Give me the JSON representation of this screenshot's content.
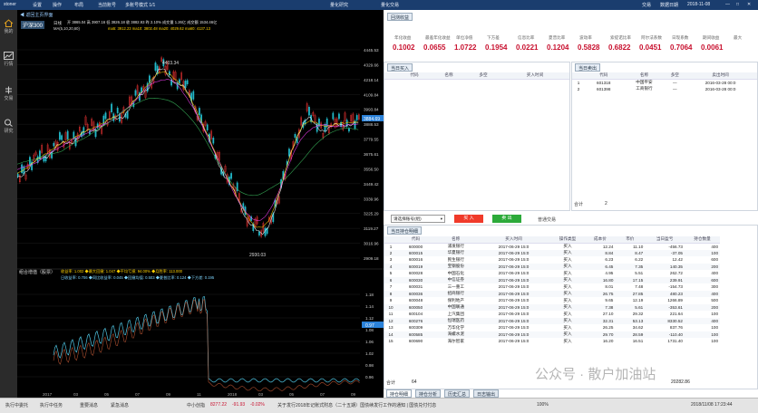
{
  "topbar": {
    "app": "stoner",
    "menu": [
      "设置",
      "操作",
      "布局",
      "当前账号",
      "多账号模式 1/1"
    ],
    "center": [
      "量化研究",
      "量化交易"
    ],
    "right": [
      "交易",
      "数据日期",
      "2018-11-08"
    ],
    "win": [
      "—",
      "□",
      "✕"
    ]
  },
  "nav": [
    {
      "label": "我的",
      "icon": "home-icon"
    },
    {
      "label": "行情",
      "icon": "chart-icon"
    },
    {
      "label": "交易",
      "icon": "trade-icon"
    },
    {
      "label": "研究",
      "icon": "research-icon"
    }
  ],
  "chart": {
    "back_label": "返回主页界面",
    "symbol": "沪深300",
    "period": "日线",
    "indicator": "MA(5,10,20,60)",
    "ohlc_line": "开 3865.04 高 3907.16 低 3826.18 收 3882.93 昨 2.10% 成交量 1.26亿 成交额 1534.46亿",
    "ma_line": "ma5: 3912.23 ma10: 3802.48 ma20: 4029.62 ma60: 4137.13",
    "high_label": "4403.34",
    "low_label": "2930.03",
    "price_ticks": [
      "4445.53",
      "4329.66",
      "4218.14",
      "4109.84",
      "3993.84",
      "3888.53",
      "3779.55",
      "3675.61",
      "3556.50",
      "3449.42",
      "3339.96",
      "3225.29",
      "3119.27",
      "3016.96",
      "2909.18"
    ],
    "current_price": "3884.69",
    "y_label": "3882.93",
    "sub_title": "组合增值（股票）",
    "sub_line1": "收益率: 1.002 ◆最大回撤: 1.047 ◆平均亏损: 94.00% ◆月胜率: 113.000",
    "sub_line2": "日收益率: 0.706 ◆同比收益率: 0.045 ◆回撤均值: 0.503 ◆夏普比率: 0.124 ◆下方差: 0.195",
    "sub_ticks": [
      "1.18",
      "1.14",
      "1.12",
      "1.08",
      "1.06",
      "1.02",
      "0.98",
      "0.96"
    ],
    "sub_current": "0.97",
    "x_ticks": [
      "2017",
      "03",
      "05",
      "07",
      "09",
      "11",
      "2018",
      "03",
      "05",
      "07",
      "09"
    ]
  },
  "results": {
    "tab": "回测收益",
    "metrics": [
      {
        "label": "年化收益",
        "value": "0.1002"
      },
      {
        "label": "最差年化收益",
        "value": "0.0655"
      },
      {
        "label": "单位净值",
        "value": "1.0722"
      },
      {
        "label": "下方差",
        "value": "0.1954"
      },
      {
        "label": "信息比率",
        "value": "0.0221"
      },
      {
        "label": "夏普比率",
        "value": "0.1204"
      },
      {
        "label": "波动率",
        "value": "0.5828"
      },
      {
        "label": "索提诺比率",
        "value": "0.6822"
      },
      {
        "label": "阿尔法系数",
        "value": "0.0451"
      },
      {
        "label": "日现系数",
        "value": "0.7064"
      },
      {
        "label": "期间收益",
        "value": "0.0061"
      },
      {
        "label": "最大"
      }
    ]
  },
  "buy_panel": {
    "tab": "当日买入",
    "cols": [
      "代码",
      "名称",
      "多空",
      "买入时间"
    ]
  },
  "sell_panel": {
    "tab": "当日卖出",
    "cols": [
      "代码",
      "名称",
      "多空",
      "卖出时间"
    ],
    "rows": [
      {
        "n": "1",
        "code": "601318",
        "name": "中国平安",
        "dir": "—",
        "time": "2016-03-28 00:0"
      },
      {
        "n": "2",
        "code": "601398",
        "name": "工商银行",
        "dir": "—",
        "time": "2016-03-28 00:0"
      }
    ],
    "total_label": "合计",
    "total_value": "2"
  },
  "controls": {
    "select": "请选择账号(组)",
    "buy": "买 入",
    "sell": "卖 出",
    "mode": "普通交易"
  },
  "holdings": {
    "tab": "当日持仓明细",
    "cols": [
      "代码",
      "名称",
      "买入时间",
      "操作类型",
      "成本价",
      "市价",
      "当日盈亏",
      "持仓数量"
    ],
    "rows": [
      [
        "1",
        "600000",
        "浦发银行",
        "2017-06-29 15:0",
        "买入",
        "12.24",
        "11.10",
        "-456.73",
        "400"
      ],
      [
        "2",
        "600015",
        "华夏银行",
        "2017-06-29 15:0",
        "买入",
        "8.84",
        "8.47",
        "-37.05",
        "100"
      ],
      [
        "3",
        "600016",
        "民生银行",
        "2017-06-29 15:0",
        "买入",
        "6.23",
        "6.22",
        "12.42",
        "600"
      ],
      [
        "4",
        "600019",
        "宝钢股份",
        "2017-06-29 15:0",
        "买入",
        "6.45",
        "7.35",
        "140.35",
        "200"
      ],
      [
        "5",
        "600028",
        "中国石化",
        "2017-06-29 15:0",
        "买入",
        "4.95",
        "5.51",
        "262.72",
        "400"
      ],
      [
        "6",
        "600030",
        "中信证券",
        "2017-06-29 15:0",
        "买入",
        "16.80",
        "17.15",
        "239.91",
        "600"
      ],
      [
        "7",
        "600031",
        "三一重工",
        "2017-06-29 15:0",
        "买入",
        "8.01",
        "7.48",
        "-154.73",
        "300"
      ],
      [
        "8",
        "600036",
        "招商银行",
        "2017-06-29 15:0",
        "买入",
        "26.75",
        "27.85",
        "480.23",
        "400"
      ],
      [
        "9",
        "600048",
        "保利地产",
        "2017-06-29 15:0",
        "买入",
        "9.65",
        "12.19",
        "1266.89",
        "500"
      ],
      [
        "10",
        "600050",
        "中国联通",
        "2017-06-29 15:0",
        "买入",
        "7.38",
        "5.61",
        "-353.61",
        "200"
      ],
      [
        "11",
        "600104",
        "上汽集团",
        "2017-06-29 15:0",
        "买入",
        "27.10",
        "29.32",
        "221.64",
        "100"
      ],
      [
        "12",
        "600276",
        "恒瑞医药",
        "2017-06-29 15:0",
        "买入",
        "32.31",
        "53.13",
        "8330.52",
        "400"
      ],
      [
        "13",
        "600309",
        "万华化学",
        "2017-06-29 15:0",
        "买入",
        "26.25",
        "34.62",
        "837.76",
        "100"
      ],
      [
        "14",
        "600585",
        "海螺水泥",
        "2017-06-29 15:0",
        "买入",
        "29.70",
        "28.59",
        "-110.40",
        "100"
      ],
      [
        "15",
        "600690",
        "海尔智家",
        "2017-06-29 15:0",
        "买入",
        "16.20",
        "16.51",
        "1731.40",
        "100"
      ]
    ],
    "total_label": "合计",
    "total_count": "64",
    "total_sum": "20282.86"
  },
  "bottom_tabs": [
    "持仓明细",
    "持仓分析",
    "历史汇总",
    "日志输出"
  ],
  "status": {
    "items": [
      "执行中委托",
      "执行中任务",
      "重要消息",
      "紧急消息",
      "中小创指",
      "8277.22",
      "-91.93",
      "-0.02%"
    ],
    "ticker": "关于发行2018年记账式附息（二十五期）国债续发行工作的通知 | 国债兑付付息",
    "zoom": "100%",
    "time": "2018/11/08 17:23:44"
  },
  "watermark": "公众号 · 散户加油站",
  "colors": {
    "up": "#e03030",
    "down": "#22b8c8",
    "ma5": "#ffffff",
    "ma10": "#ffd200",
    "ma20": "#ff40ff",
    "ma60": "#3cc060",
    "accent": "#c8102e"
  }
}
